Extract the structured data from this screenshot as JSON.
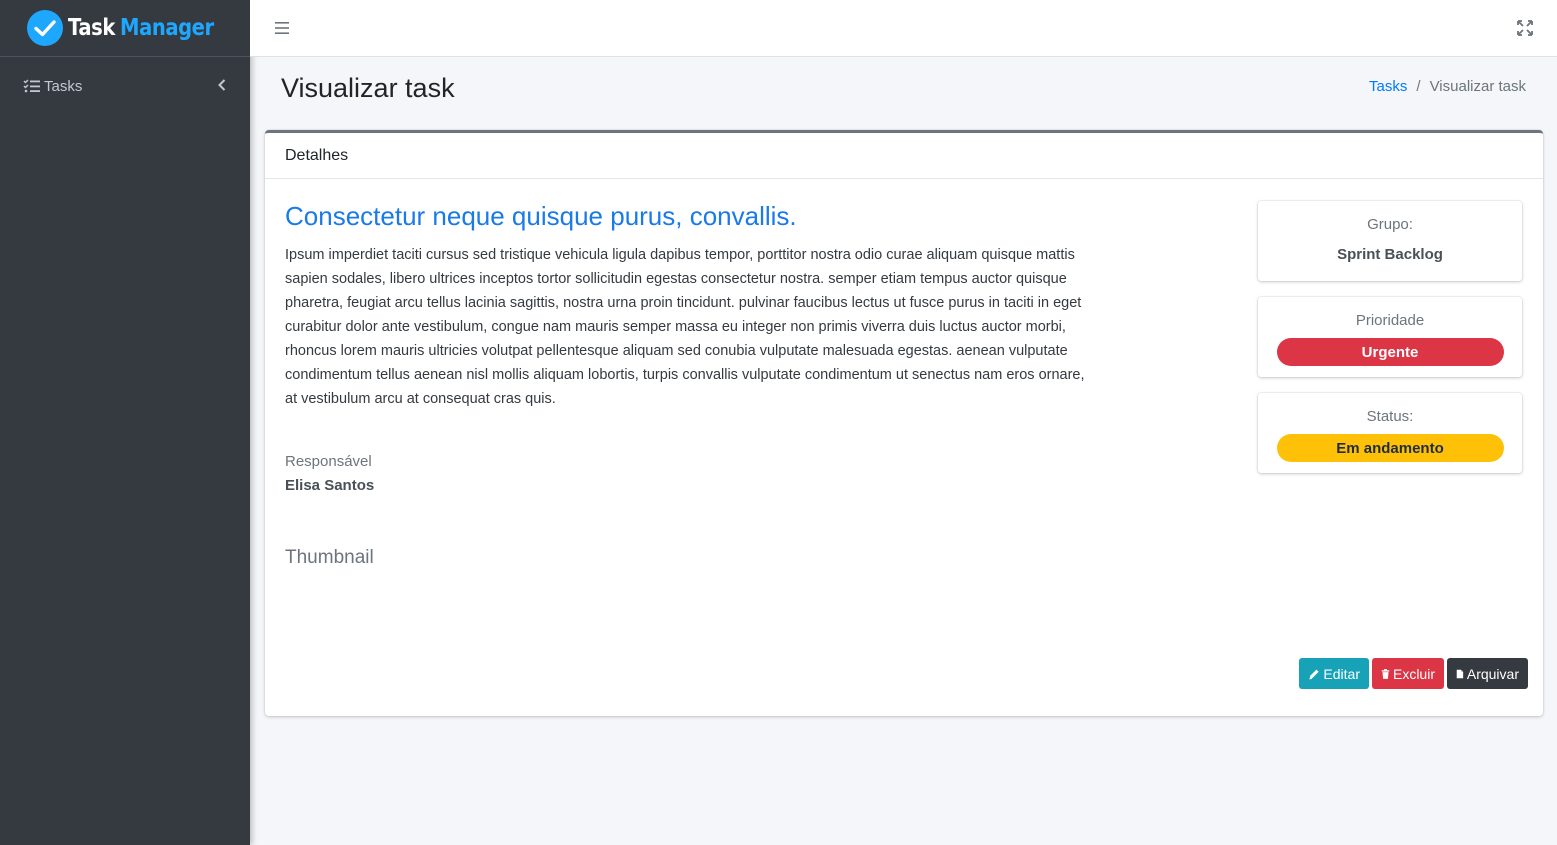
{
  "brand": {
    "word1": "Task",
    "word2": "Manager"
  },
  "sidebar": {
    "items": [
      {
        "label": "Tasks"
      }
    ]
  },
  "page": {
    "title": "Visualizar task"
  },
  "breadcrumb": {
    "link": "Tasks",
    "separator": "/",
    "current": "Visualizar task"
  },
  "card": {
    "header": "Detalhes",
    "task_title": "Consectetur neque quisque purus, convallis.",
    "description": "Ipsum imperdiet taciti cursus sed tristique vehicula ligula dapibus tempor, porttitor nostra odio curae aliquam quisque mattis sapien sodales, libero ultrices inceptos tortor sollicitudin egestas consectetur nostra. semper etiam tempus auctor quisque pharetra, feugiat arcu tellus lacinia sagittis, nostra urna proin tincidunt. pulvinar faucibus lectus ut fusce purus in taciti in eget curabitur dolor ante vestibulum, congue nam mauris semper massa eu integer non primis viverra duis luctus auctor morbi, rhoncus lorem mauris ultricies volutpat pellentesque aliquam sed conubia vulputate malesuada egestas. aenean vulputate condimentum tellus aenean nisl mollis aliquam lobortis, turpis convallis vulputate condimentum ut senectus nam eros ornare, at vestibulum arcu at consequat cras quis.",
    "responsavel_label": "Responsável",
    "responsavel_name": "Elisa Santos",
    "thumbnail_label": "Thumbnail"
  },
  "info": {
    "grupo": {
      "label": "Grupo:",
      "value": "Sprint Backlog"
    },
    "prioridade": {
      "label": "Prioridade",
      "value": "Urgente",
      "color": "#dc3545"
    },
    "status": {
      "label": "Status:",
      "value": "Em andamento",
      "color": "#ffc107"
    }
  },
  "actions": {
    "edit": {
      "label": "Editar",
      "color": "#17a2b8"
    },
    "delete": {
      "label": "Excluir",
      "color": "#dc3545"
    },
    "archive": {
      "label": "Arquivar",
      "color": "#343a40"
    }
  },
  "colors": {
    "sidebar": "#343a40",
    "accent": "#1ea7ff",
    "link": "#007bff"
  }
}
